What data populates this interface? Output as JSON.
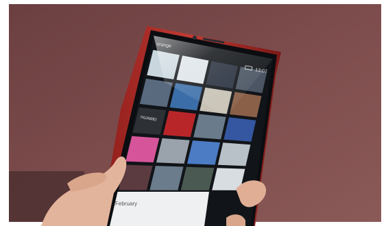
{
  "status_bar": {
    "carrier": "orange",
    "time": "13:07"
  },
  "gallery": {
    "section_label": "February"
  },
  "tiles": [
    {
      "row": 0,
      "col": 0,
      "color": "#c9d6de"
    },
    {
      "row": 0,
      "col": 1,
      "color": "#dfe5ea"
    },
    {
      "row": 0,
      "col": 2,
      "color": "#2a3240"
    },
    {
      "row": 0,
      "col": 3,
      "color": "#4b5563"
    },
    {
      "row": 1,
      "col": 0,
      "color": "#5a6a7e"
    },
    {
      "row": 1,
      "col": 1,
      "color": "#3b6ea8"
    },
    {
      "row": 1,
      "col": 2,
      "color": "#c8c2b5"
    },
    {
      "row": 1,
      "col": 3,
      "color": "#8a6048"
    },
    {
      "row": 2,
      "col": 0,
      "color": "#2d3035"
    },
    {
      "row": 2,
      "col": 1,
      "color": "#b8262a"
    },
    {
      "row": 2,
      "col": 2,
      "color": "#6a7b8b"
    },
    {
      "row": 2,
      "col": 3,
      "color": "#3556a0"
    },
    {
      "row": 3,
      "col": 0,
      "color": "#d6559a"
    },
    {
      "row": 3,
      "col": 1,
      "color": "#9aa3ab"
    },
    {
      "row": 3,
      "col": 2,
      "color": "#4b7cc4"
    },
    {
      "row": 3,
      "col": 3,
      "color": "#b8c0c8"
    },
    {
      "row": 4,
      "col": 0,
      "color": "#5b3a40"
    },
    {
      "row": 4,
      "col": 1,
      "color": "#6b7c8c"
    },
    {
      "row": 4,
      "col": 2,
      "color": "#4a5a52"
    },
    {
      "row": 4,
      "col": 3,
      "color": "#d8dde2"
    }
  ],
  "tile_text": {
    "huawei_label": "HUAWEI"
  },
  "colors": {
    "wall": "#7a4a4a",
    "phone_frame": "#b3322c",
    "screen_bg": "#111418",
    "skin": "#e2b49a"
  }
}
